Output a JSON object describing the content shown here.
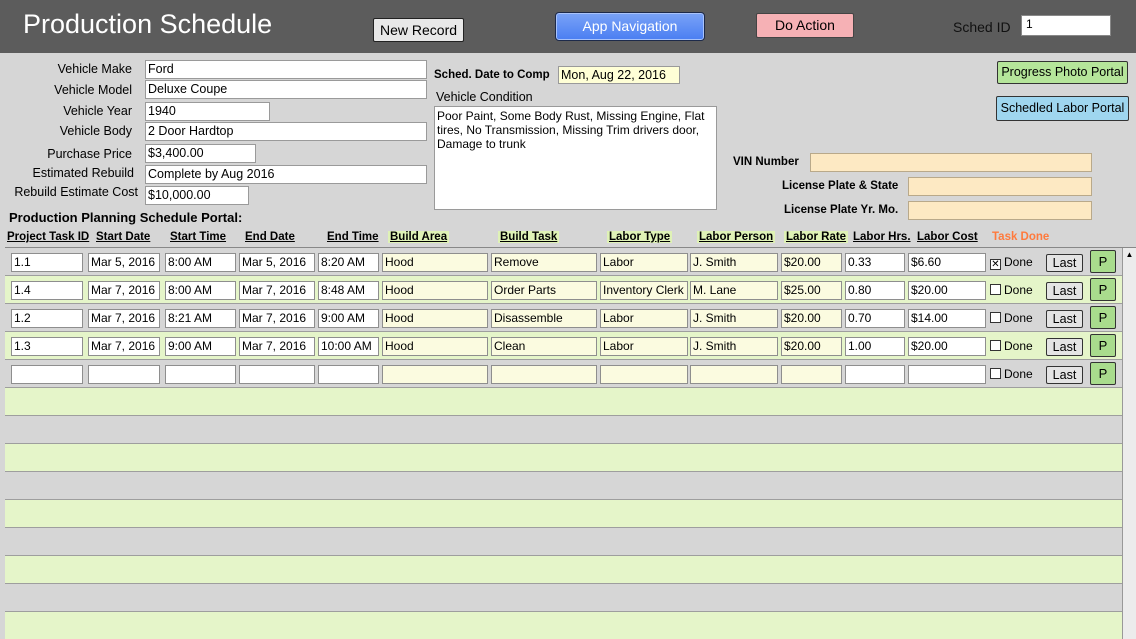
{
  "header": {
    "title": "Production Schedule",
    "new_record": "New Record",
    "app_navigation": "App Navigation",
    "do_action": "Do Action",
    "sched_id_label": "Sched ID",
    "sched_id_value": "1"
  },
  "vehicle": {
    "make_label": "Vehicle Make",
    "make": "Ford",
    "model_label": "Vehicle Model",
    "model": "Deluxe Coupe",
    "year_label": "Vehicle Year",
    "year": "1940",
    "body_label": "Vehicle Body",
    "body": "2 Door Hardtop",
    "price_label": "Purchase Price",
    "price": "$3,400.00",
    "est_rebuild_label": "Estimated Rebuild",
    "est_rebuild": "Complete by Aug 2016",
    "rebuild_cost_label": "Rebuild Estimate Cost",
    "rebuild_cost": "$10,000.00"
  },
  "schedule": {
    "date_label": "Sched. Date to Comp",
    "date": "Mon, Aug 22, 2016",
    "condition_label": "Vehicle Condition",
    "condition": "Poor Paint, Some Body Rust, Missing Engine, Flat tires, No Transmission, Missing Trim drivers door, Damage to trunk"
  },
  "side_buttons": {
    "photo_portal": "Progress Photo Portal",
    "labor_portal": "Schedled Labor Portal"
  },
  "registration": {
    "vin_label": "VIN Number",
    "vin": "",
    "plate_label": "License Plate & State",
    "plate": "",
    "plate_date_label": "License Plate Yr. Mo.",
    "plate_date": ""
  },
  "portal": {
    "title": "Production Planning Schedule Portal:",
    "columns": {
      "task_id": "Project Task ID",
      "start_date": "Start Date",
      "start_time": "Start Time",
      "end_date": "End Date",
      "end_time": "End Time",
      "build_area": "Build Area",
      "build_task": "Build Task",
      "labor_type": "Labor Type",
      "labor_person": "Labor Person",
      "labor_rate": "Labor Rate",
      "labor_hrs": "Labor Hrs.",
      "labor_cost": "Labor Cost",
      "task_done": "Task Done"
    },
    "done_label": "Done",
    "last_label": "Last",
    "p_label": "P",
    "checked_mark": "✕",
    "rows": [
      {
        "task_id": "1.1",
        "start_date": "Mar 5, 2016",
        "start_time": "8:00 AM",
        "end_date": "Mar 5, 2016",
        "end_time": "8:20 AM",
        "build_area": "Hood",
        "build_task": "Remove",
        "labor_type": "Labor",
        "labor_person": "J. Smith",
        "labor_rate": "$20.00",
        "labor_hrs": "0.33",
        "labor_cost": "$6.60",
        "done": true
      },
      {
        "task_id": "1.4",
        "start_date": "Mar 7, 2016",
        "start_time": "8:00 AM",
        "end_date": "Mar 7, 2016",
        "end_time": "8:48 AM",
        "build_area": "Hood",
        "build_task": "Order Parts",
        "labor_type": "Inventory Clerk",
        "labor_person": "M. Lane",
        "labor_rate": "$25.00",
        "labor_hrs": "0.80",
        "labor_cost": "$20.00",
        "done": false
      },
      {
        "task_id": "1.2",
        "start_date": "Mar 7, 2016",
        "start_time": "8:21 AM",
        "end_date": "Mar 7, 2016",
        "end_time": "9:00 AM",
        "build_area": "Hood",
        "build_task": "Disassemble",
        "labor_type": "Labor",
        "labor_person": "J. Smith",
        "labor_rate": "$20.00",
        "labor_hrs": "0.70",
        "labor_cost": "$14.00",
        "done": false
      },
      {
        "task_id": "1.3",
        "start_date": "Mar 7, 2016",
        "start_time": "9:00 AM",
        "end_date": "Mar 7, 2016",
        "end_time": "10:00 AM",
        "build_area": "Hood",
        "build_task": "Clean",
        "labor_type": "Labor",
        "labor_person": "J. Smith",
        "labor_rate": "$20.00",
        "labor_hrs": "1.00",
        "labor_cost": "$20.00",
        "done": false
      },
      {
        "task_id": "",
        "start_date": "",
        "start_time": "",
        "end_date": "",
        "end_time": "",
        "build_area": "",
        "build_task": "",
        "labor_type": "",
        "labor_person": "",
        "labor_rate": "",
        "labor_hrs": "",
        "labor_cost": "",
        "done": false
      }
    ]
  }
}
